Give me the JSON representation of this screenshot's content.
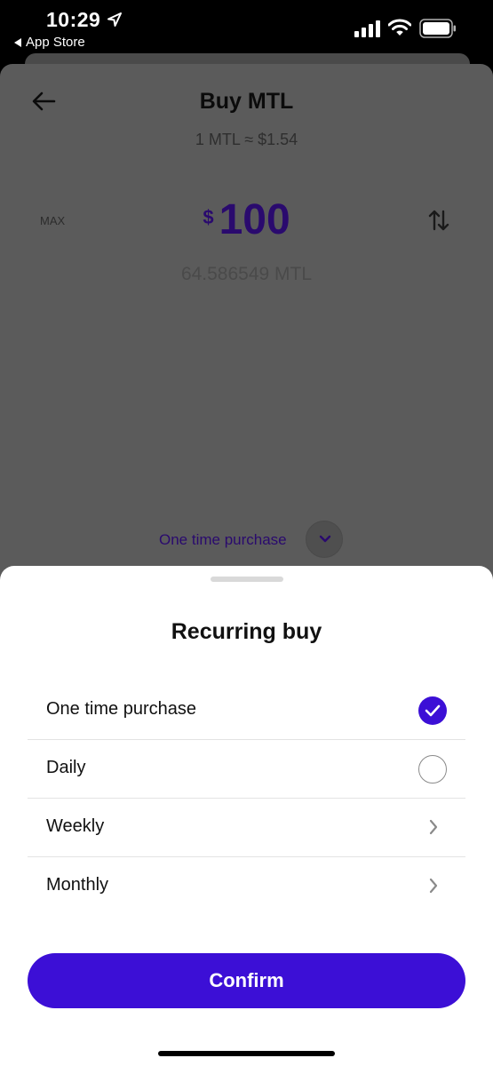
{
  "status_bar": {
    "time": "10:29",
    "back_app": "App Store",
    "icons": [
      "location-arrow-icon",
      "signal-icon",
      "wifi-icon",
      "battery-icon"
    ]
  },
  "background_screen": {
    "title": "Buy MTL",
    "rate": "1 MTL ≈ $1.54",
    "max_label": "MAX",
    "currency_symbol": "$",
    "amount": "100",
    "crypto_amount": "64.586549 MTL",
    "frequency_label": "One time purchase",
    "icons": [
      "back-arrow-icon",
      "swap-icon",
      "chevron-down-icon"
    ]
  },
  "sheet": {
    "title": "Recurring buy",
    "options": [
      {
        "label": "One time purchase",
        "state": "selected"
      },
      {
        "label": "Daily",
        "state": "unselected"
      },
      {
        "label": "Weekly",
        "state": "submenu"
      },
      {
        "label": "Monthly",
        "state": "submenu"
      }
    ],
    "confirm_label": "Confirm"
  },
  "colors": {
    "accent": "#3c0fd6",
    "overlay": "#5b5b5b",
    "amount_text": "#2a0a6e"
  }
}
